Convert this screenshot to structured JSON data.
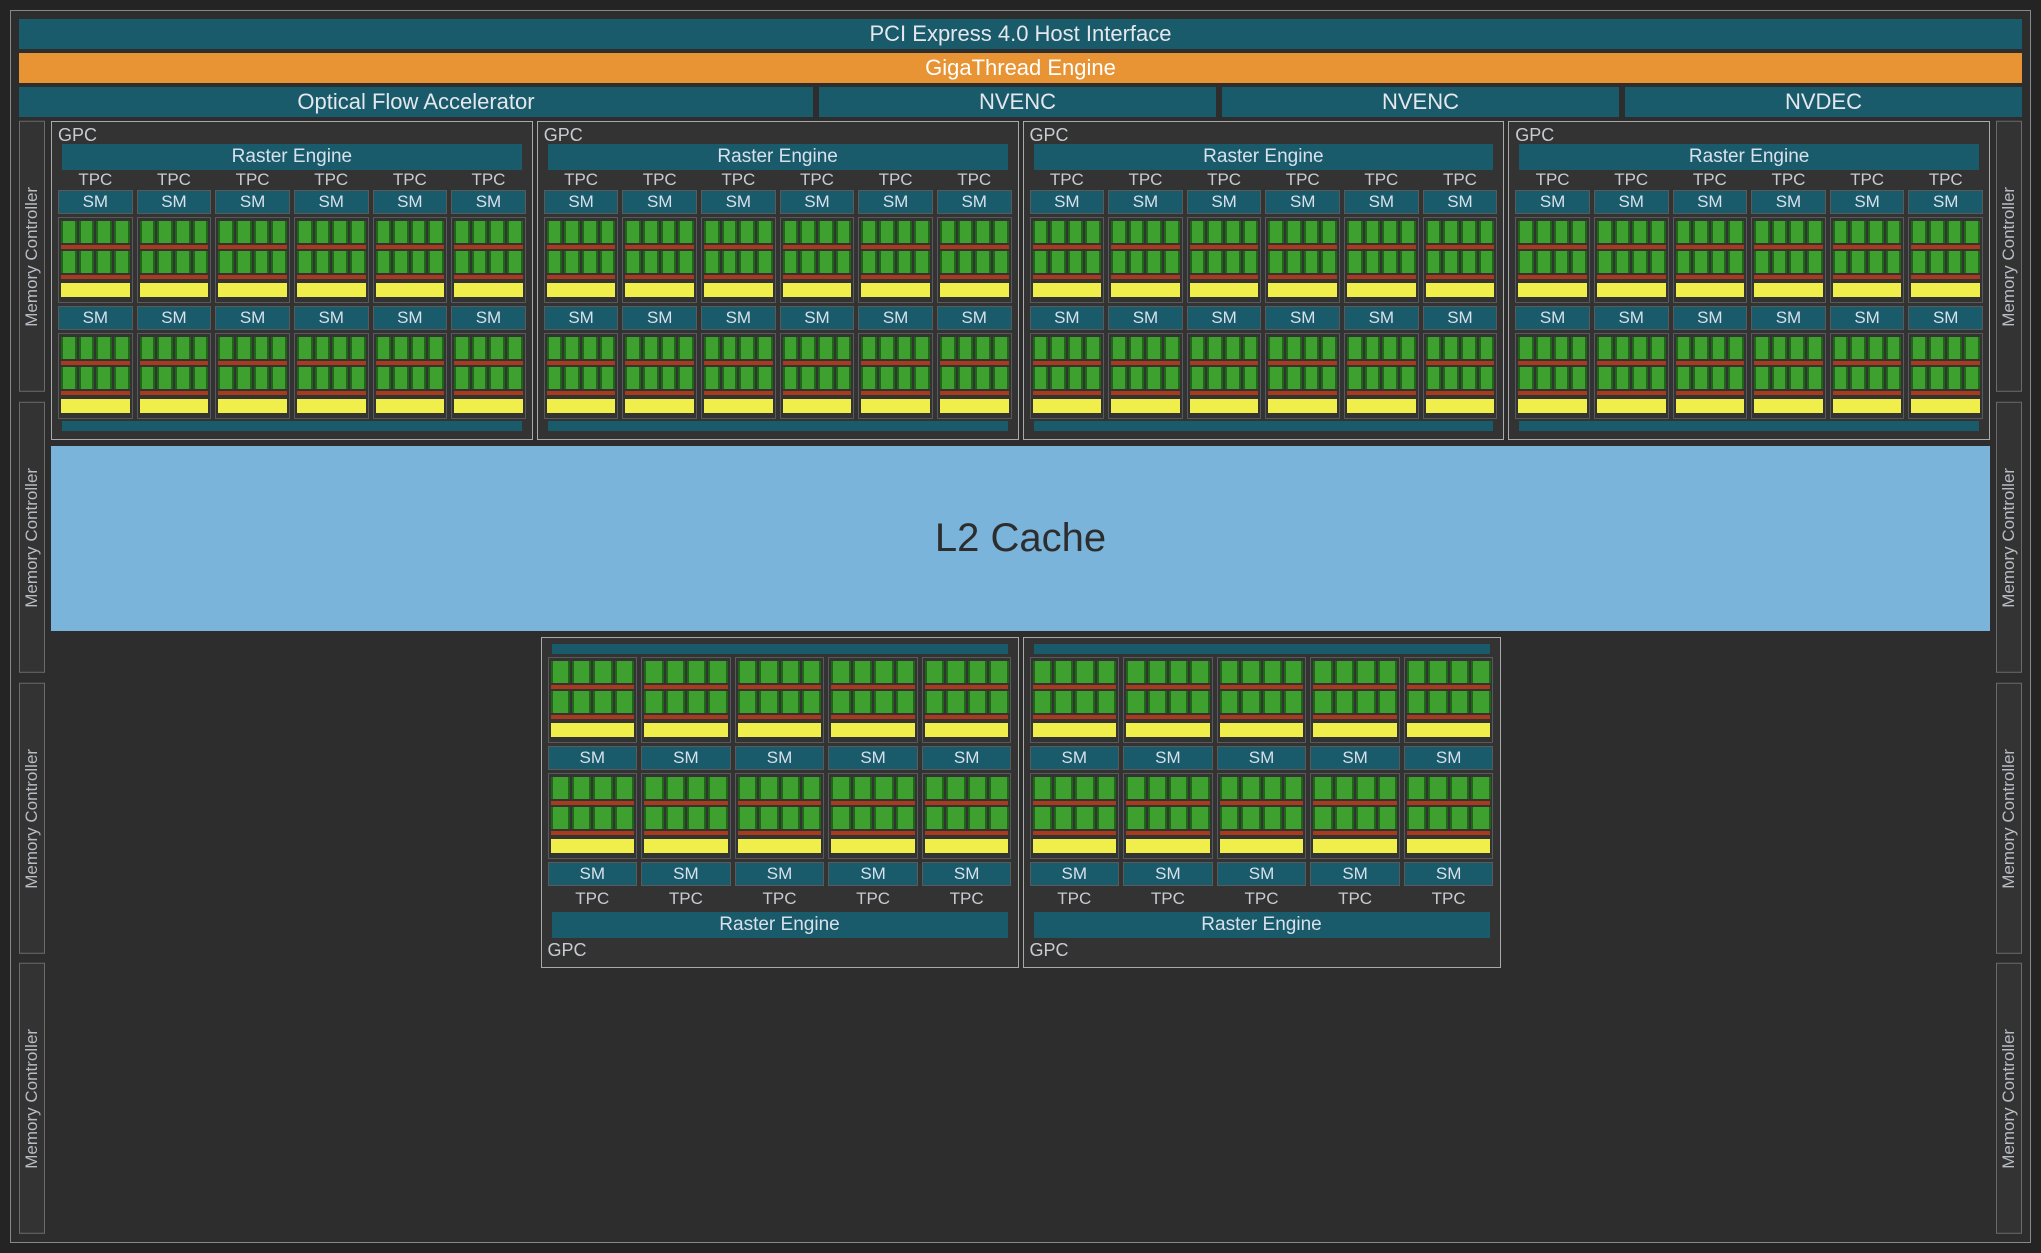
{
  "bars": {
    "pci": "PCI Express 4.0 Host Interface",
    "gt": "GigaThread Engine"
  },
  "engines": {
    "ofa": "Optical Flow Accelerator",
    "nvenc": "NVENC",
    "nvdec": "NVDEC"
  },
  "memctl": "Memory Controller",
  "gpc": {
    "label": "GPC",
    "raster": "Raster Engine",
    "tpc": "TPC",
    "sm": "SM"
  },
  "l2": "L2 Cache",
  "layout": {
    "top_gpc_count": 4,
    "top_gpc_tpcs": 6,
    "bottom_gpc_count": 2,
    "bottom_gpc_tpcs": 5,
    "sms_per_tpc": 2,
    "mem_controllers_per_side": 4
  }
}
